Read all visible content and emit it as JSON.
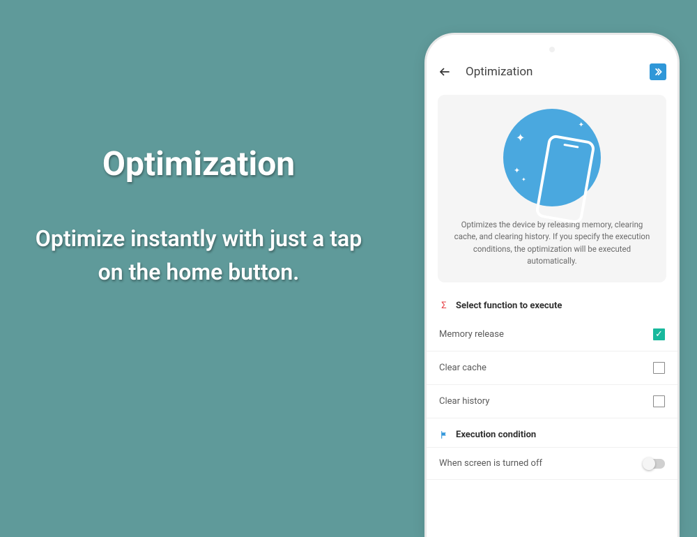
{
  "promo": {
    "title": "Optimization",
    "subtitle": "Optimize instantly with just a tap on the home button."
  },
  "app_bar": {
    "title": "Optimization"
  },
  "info_card": {
    "description": "Optimizes the device by releasing memory, clearing cache, and clearing history. If you specify the execution conditions, the optimization will be executed automatically."
  },
  "sections": {
    "functions": {
      "title": "Select function to execute",
      "items": [
        {
          "label": "Memory release",
          "checked": true
        },
        {
          "label": "Clear cache",
          "checked": false
        },
        {
          "label": "Clear history",
          "checked": false
        }
      ]
    },
    "execution": {
      "title": "Execution condition",
      "items": [
        {
          "label": "When screen is turned off",
          "enabled": false
        }
      ]
    }
  }
}
